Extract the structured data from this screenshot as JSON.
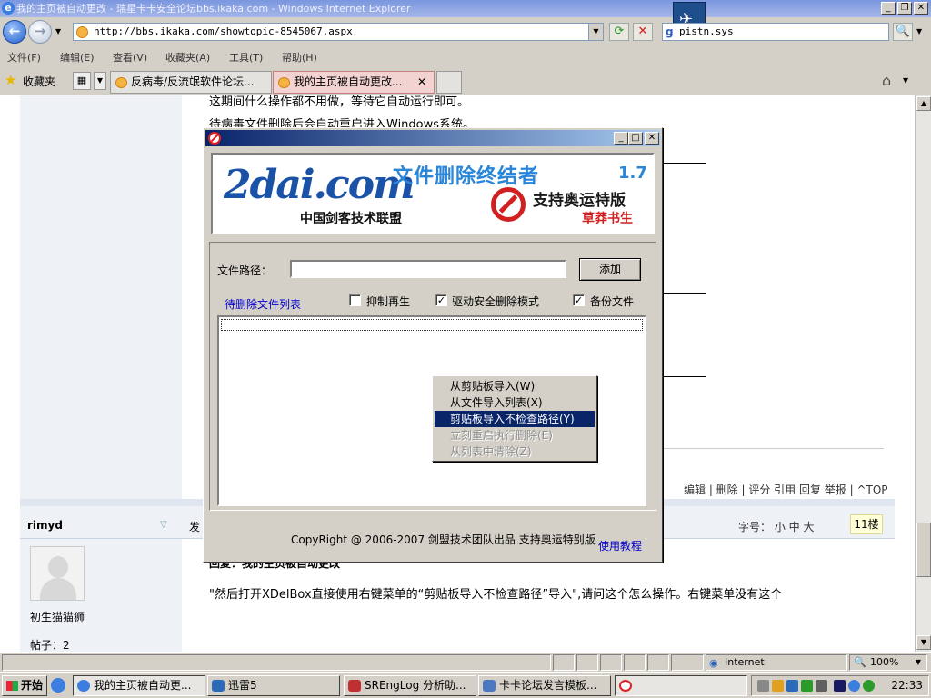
{
  "browser": {
    "title": "我的主页被自动更改 - 瑞星卡卡安全论坛bbs.ikaka.com - Windows Internet Explorer",
    "url": "http://bbs.ikaka.com/showtopic-8545067.aspx",
    "search_value": "pistn.sys",
    "menu": [
      "文件(F)",
      "编辑(E)",
      "查看(V)",
      "收藏夹(A)",
      "工具(T)",
      "帮助(H)"
    ],
    "favorites_label": "收藏夹",
    "tabs": [
      {
        "label": "反病毒/反流氓软件论坛..."
      },
      {
        "label": "我的主页被自动更改..."
      }
    ]
  },
  "page": {
    "text_line1": "这期间什么操作都不用做，等待它自动运行即可。",
    "text_line2": "待病毒文件删除后会自动重启进入Windows系统。",
    "post_actions": "编辑 | 删除 | 评分  引用  回复  举报 | ^TOP",
    "username": "rimyd",
    "rank": "初生猫猫狮",
    "posts": "帖子：2",
    "font_size_label": "字号：  小   中   大",
    "floor": "11楼",
    "reply_title": "回复：我的主页被自动更改",
    "reply_text": "\"然后打开XDelBox直接使用右键菜单的“剪贴板导入不检查路径”导入\",请问这个怎么操作。右键菜单没有这个",
    "fa_label": "发"
  },
  "dialog": {
    "banner": {
      "logo": "2dai.com",
      "org": "中国剑客技术联盟",
      "title": "文件删除终结者",
      "version": "1.7",
      "olympic": "支持奥运特版",
      "author": "草莽书生"
    },
    "path_label": "文件路径：",
    "path_value": "",
    "add_button": "添加",
    "list_link": "待删除文件列表",
    "checkboxes": [
      {
        "label": "抑制再生",
        "checked": false
      },
      {
        "label": "驱动安全删除模式",
        "checked": true
      },
      {
        "label": "备份文件",
        "checked": true
      }
    ],
    "copyright": "CopyRight @ 2006-2007 剑盟技术团队出品 支持奥运特别版",
    "tutorial": "使用教程"
  },
  "context_menu": {
    "items": [
      {
        "label": "从剪贴板导入(W)",
        "state": "normal"
      },
      {
        "label": "从文件导入列表(X)",
        "state": "normal"
      },
      {
        "label": "剪贴板导入不检查路径(Y)",
        "state": "highlighted"
      },
      {
        "label": "立刻重启执行删除(E)",
        "state": "disabled"
      },
      {
        "label": "从列表中清除(Z)",
        "state": "disabled"
      }
    ]
  },
  "status": {
    "zone": "Internet",
    "zoom": "100%"
  },
  "taskbar": {
    "start": "开始",
    "tasks": [
      {
        "label": "我的主页被自动更..."
      },
      {
        "label": "迅雷5"
      },
      {
        "label": "SREngLog 分析助..."
      },
      {
        "label": "卡卡论坛发言模板..."
      }
    ],
    "clock": "22:33"
  }
}
